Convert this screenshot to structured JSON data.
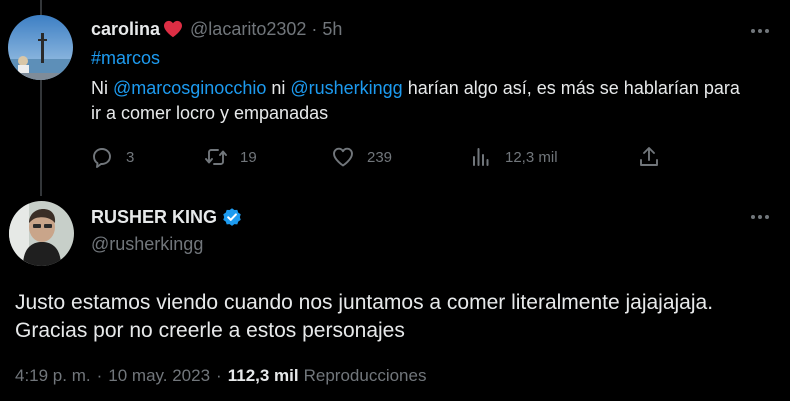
{
  "reply_tweet": {
    "display_name": "carolina",
    "handle": "@lacarito2302",
    "separator": "·",
    "time": "5h",
    "hashtag": "#marcos",
    "text_part1": "Ni ",
    "mention1": "@marcosginocchio",
    "text_part2": " ni ",
    "mention2": "@rusherkingg",
    "text_part3": " harían algo así, es más se hablarían para ir a comer locro y empanadas",
    "actions": {
      "replies": "3",
      "retweets": "19",
      "likes": "239",
      "views": "12,3 mil"
    },
    "heart_color": "#f91880"
  },
  "main_tweet": {
    "display_name": "RUSHER KING",
    "handle": "@rusherkingg",
    "text": "Justo estamos viendo cuando nos juntamos a comer literalmente jajajajaja. Gracias por no creerle a estos personajes",
    "time": "4:19 p. m.",
    "date": "10 may. 2023",
    "separator": "·",
    "views_count": "112,3 mil",
    "views_label": "Reproducciones",
    "verified_color": "#1d9bf0"
  },
  "icons": [
    "reply-icon",
    "retweet-icon",
    "like-icon",
    "views-icon",
    "share-icon",
    "more-icon",
    "verified-icon",
    "heart-emoji-icon"
  ]
}
